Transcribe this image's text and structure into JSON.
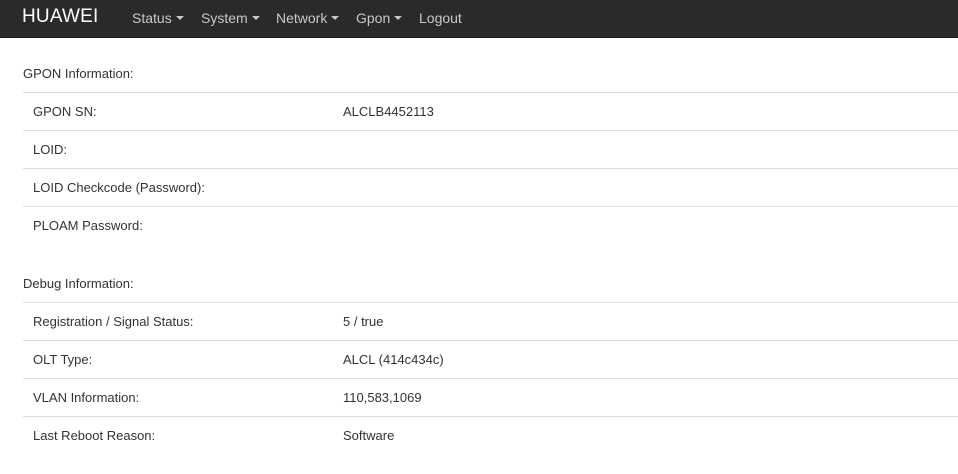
{
  "navbar": {
    "brand": "HUAWEI",
    "items": [
      {
        "label": "Status",
        "has_dropdown": true
      },
      {
        "label": "System",
        "has_dropdown": true
      },
      {
        "label": "Network",
        "has_dropdown": true
      },
      {
        "label": "Gpon",
        "has_dropdown": true
      },
      {
        "label": "Logout",
        "has_dropdown": false
      }
    ],
    "background": "#2a2a2a"
  },
  "gpon": {
    "title": "GPON Information:",
    "rows": [
      {
        "label": "GPON SN:",
        "value": "ALCLB4452113"
      },
      {
        "label": "LOID:",
        "value": ""
      },
      {
        "label": "LOID Checkcode (Password):",
        "value": ""
      },
      {
        "label": "PLOAM Password:",
        "value": ""
      }
    ]
  },
  "debug": {
    "title": "Debug Information:",
    "rows": [
      {
        "label": "Registration / Signal Status:",
        "value": "5 / true"
      },
      {
        "label": "OLT Type:",
        "value": "ALCL (414c434c)"
      },
      {
        "label": "VLAN Information:",
        "value": "110,583,1069"
      },
      {
        "label": "Last Reboot Reason:",
        "value": "Software"
      }
    ]
  }
}
